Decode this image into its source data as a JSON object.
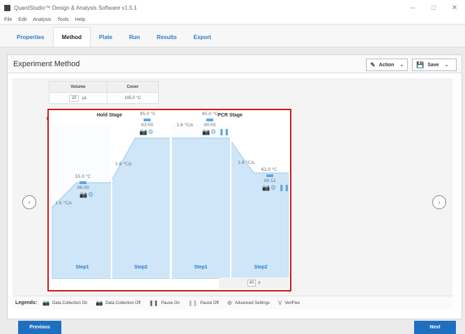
{
  "window": {
    "title": "QuantStudio™ Design & Analysis Software v1.5.1",
    "minimize": "–",
    "maximize": "□",
    "close": "✕"
  },
  "menu": [
    "File",
    "Edit",
    "Analysis",
    "Tools",
    "Help"
  ],
  "tabs": [
    "Properties",
    "Method",
    "Plate",
    "Run",
    "Results",
    "Export"
  ],
  "panel": {
    "title": "Experiment Method",
    "action_label": "Action",
    "save_label": "Save"
  },
  "settings": {
    "volume_header": "Volume",
    "cover_header": "Cover",
    "volume_value": "20",
    "volume_unit": "µL",
    "cover_value": "105.0 °C"
  },
  "stages": {
    "hold": {
      "title": "Hold Stage",
      "step1": {
        "temp": "55.0 °C",
        "time": "06:00",
        "rate": "1.6 °C/s",
        "label": "Step1"
      },
      "step2": {
        "temp": "95.0 °C",
        "time": "03:00",
        "rate": "1.6 °C/s",
        "label": "Step2"
      }
    },
    "pcr": {
      "title": "PCR Stage",
      "step1": {
        "temp": "95.0 °C",
        "time": "00:05",
        "rate": "1.6 °C/s",
        "label": "Step1"
      },
      "step2": {
        "temp": "62.0 °C",
        "time": "00:12",
        "rate": "1.6 °C/s",
        "label": "Step2"
      },
      "cycles": "40",
      "cycles_suffix": "x"
    }
  },
  "legend": {
    "title": "Legends:",
    "data_on": "Data Collection On",
    "data_off": "Data Collection Off",
    "pause_on": "Pause On",
    "pause_off": "Pause Off",
    "advanced": "Advanced Settings",
    "veriflex": "VeriFlex",
    "veriflex_icon": "V"
  },
  "footer": {
    "previous": "Previous",
    "next": "Next"
  },
  "colors": {
    "accent": "#1f6fbf",
    "highlight": "#d01818",
    "profile_fill": "#cfe6f8",
    "profile_line": "#9bc9ec"
  }
}
